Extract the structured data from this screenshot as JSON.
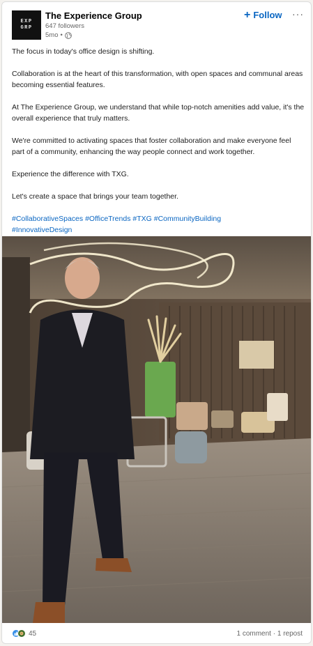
{
  "post": {
    "company": {
      "name": "The Experience Group",
      "followers": "647 followers",
      "time": "5mo",
      "visibility_icon": "globe-icon",
      "logo_lines": [
        "EXP",
        "GRP"
      ]
    },
    "follow_label": "Follow",
    "more_label": "···",
    "paragraphs": [
      "The focus in today's office design is shifting.",
      "Collaboration is at the heart of this transformation, with open spaces and communal areas becoming essential features.",
      "At The Experience Group, we understand that while top-notch amenities add value, it's the overall experience that truly matters.",
      "We're committed to activating spaces that foster collaboration and make everyone feel part of a community, enhancing the way people connect and work together.",
      "Experience the difference with TXG.",
      "Let's create a space that brings your team together."
    ],
    "hashtags": [
      "#CollaborativeSpaces",
      "#OfficeTrends",
      "#TXG",
      "#CommunityBuilding",
      "#InnovativeDesign"
    ],
    "reactions": {
      "count": "45",
      "icons": [
        "like-icon",
        "celebrate-icon"
      ]
    },
    "comments": "1 comment",
    "separator": "·",
    "reposts": "1 repost"
  },
  "colors": {
    "link_blue": "#0a66c2",
    "like_blue": "#378fe9",
    "celebrate_green": "#44712e"
  }
}
